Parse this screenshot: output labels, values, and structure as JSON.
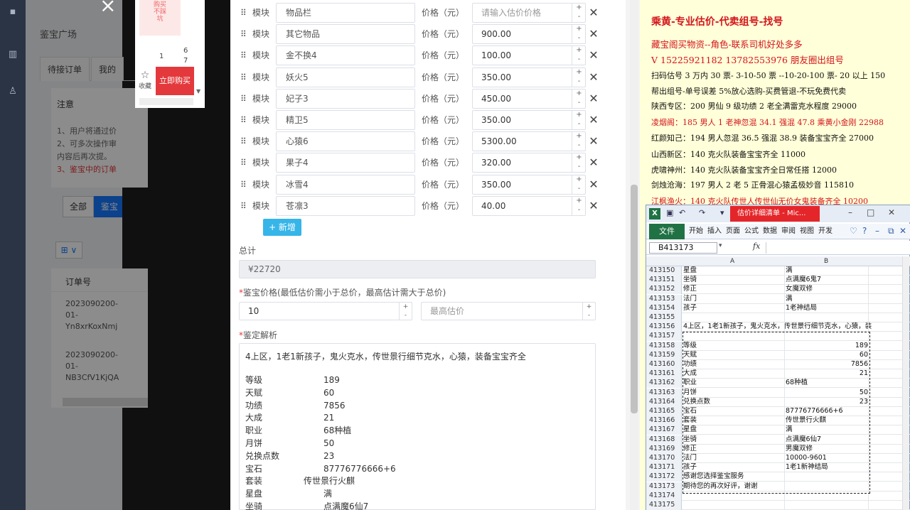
{
  "rail": {
    "icons": [
      "chart-icon",
      "user-icon"
    ]
  },
  "background_app": {
    "title": "鉴宝广场",
    "tabs": [
      "待接订单",
      "我的"
    ],
    "notice_title": "注意",
    "notice_lines": [
      "1、用户将通过价",
      "2、可多次操作审",
      "内容后再次提。",
      "3、鉴宝中的订单"
    ],
    "filter_all": "全部",
    "filter_active": "鉴宝",
    "grid_button": "⊞ ∨",
    "table_header": "订单号",
    "rows": [
      [
        "2023090200-",
        "01-",
        "Yn8xrKoxNmj"
      ],
      [
        "2023090200-",
        "01-",
        "NB3CfV1KjQA"
      ]
    ]
  },
  "ad_widget": {
    "image_text": "购买\n不踩\n坑",
    "nums": [
      "1",
      "6",
      "7"
    ],
    "fav_label": "收藏",
    "buy_label": "立即购买"
  },
  "form": {
    "module_label": "模块",
    "price_label": "价格（元）",
    "price_placeholder": "请输入估价价格",
    "modules": [
      {
        "name": "物品栏",
        "price": ""
      },
      {
        "name": "其它物品",
        "price": "900.00"
      },
      {
        "name": "金不换4",
        "price": "100.00"
      },
      {
        "name": "妖火5",
        "price": "350.00"
      },
      {
        "name": "妃子3",
        "price": "450.00"
      },
      {
        "name": "精卫5",
        "price": "350.00"
      },
      {
        "name": "心猿6",
        "price": "5300.00"
      },
      {
        "name": "果子4",
        "price": "320.00"
      },
      {
        "name": "冰雪4",
        "price": "350.00"
      },
      {
        "name": "苍凛3",
        "price": "40.00"
      }
    ],
    "add_button": "+ 新增",
    "total_label": "总计",
    "total_value": "¥22720",
    "appraise_label": "鉴宝价格(最低估价需小于总价，最高估计需大于总价)",
    "min_price": "10",
    "max_placeholder": "最高估价",
    "analysis_label": "鉴定解析",
    "analysis_summary": "4上区，1老1新孩子，鬼火克水，传世景行细节克水，心猿，装备宝宝齐全",
    "analysis_rows": [
      {
        "k": "等级",
        "v": "189"
      },
      {
        "k": "天赋",
        "v": "60"
      },
      {
        "k": "功绩",
        "v": "7856"
      },
      {
        "k": "大成",
        "v": "21"
      },
      {
        "k": "职业",
        "v": "68种植"
      },
      {
        "k": "月饼",
        "v": "50"
      },
      {
        "k": "兑换点数",
        "v": "23"
      },
      {
        "k": "宝石",
        "v": "87776776666+6"
      },
      {
        "k": "套装",
        "v": "传世景行火麒"
      },
      {
        "k": "星盘",
        "v": "满"
      },
      {
        "k": "坐骑",
        "v": "点满魔6仙7"
      }
    ]
  },
  "doc": {
    "heading": "乘黄-专业估价-代卖组号-找号",
    "line1": "藏宝阁买物资--角色-联系司机好处多多",
    "line2": "V 15225921182      13782553976 朋友圈出组号",
    "line3": "扫码估号 3 万内 30 票- 3-10-50 票  --10-20-100 票- 20 以上 150",
    "line4": "帮出组号-单号误差 5%放心选购-买费管退-不玩免费代卖",
    "line5": "陕西专区：200 男仙 9 级功绩 2 老全满雷克水程度 29000",
    "line6": "凌烟阁：185 男人 1 老神忽混 34.1 强混 47.8 乘黄小金刚 22988",
    "line7": "红颜知己：194 男人忽混 36.5 强混 38.9 装备宝宝齐全 27000",
    "line8": "山西新区：140 克火队装备宝宝齐全 11000",
    "line9": "虎啸神州：140 克火队装备宝宝齐全日常任搭 12000",
    "line10": "剑烛沧海：197 男人 2 老 5 正骨混心猿孟极妙音 115810",
    "line11": "江枫渔火：140 克火队传世人传世仙无价女鬼装备齐全 10200"
  },
  "excel": {
    "window_title": "估价详细清单 - Mic...",
    "file_tab": "文件",
    "ribbon_tabs": [
      "开始",
      "插入",
      "页面",
      "公式",
      "数据",
      "审阅",
      "视图",
      "开发"
    ],
    "name_box": "B413173",
    "fx": "fx",
    "col_a": "A",
    "col_b": "B",
    "rows": [
      {
        "n": "413150",
        "a": "星盘",
        "b": "满"
      },
      {
        "n": "413151",
        "a": "坐骑",
        "b": "点满魔6鬼7"
      },
      {
        "n": "413152",
        "a": "修正",
        "b": "女魔双修"
      },
      {
        "n": "413153",
        "a": "法门",
        "b": "满"
      },
      {
        "n": "413154",
        "a": "孩子",
        "b": "1老神结局"
      },
      {
        "n": "413155",
        "a": "",
        "b": ""
      },
      {
        "n": "413156",
        "a": "4上区，1老1新孩子，鬼火克水，传世景行细节克水，心猿，装",
        "b": ""
      },
      {
        "n": "413157",
        "a": "",
        "b": ""
      },
      {
        "n": "413158",
        "a": "等级",
        "b": "189",
        "num": true
      },
      {
        "n": "413159",
        "a": "天赋",
        "b": "60",
        "num": true
      },
      {
        "n": "413160",
        "a": "功绩",
        "b": "7856",
        "num": true
      },
      {
        "n": "413161",
        "a": "大成",
        "b": "21",
        "num": true
      },
      {
        "n": "413162",
        "a": "职业",
        "b": "68种植"
      },
      {
        "n": "413163",
        "a": "月饼",
        "b": "50",
        "num": true
      },
      {
        "n": "413164",
        "a": "兑换点数",
        "b": "23",
        "num": true
      },
      {
        "n": "413165",
        "a": "宝石",
        "b": "87776776666+6"
      },
      {
        "n": "413166",
        "a": "套装",
        "b": "传世景行火麒"
      },
      {
        "n": "413167",
        "a": "星盘",
        "b": "满"
      },
      {
        "n": "413168",
        "a": "坐骑",
        "b": "点满魔6仙7"
      },
      {
        "n": "413169",
        "a": "修正",
        "b": "男魔双修"
      },
      {
        "n": "413170",
        "a": "法门",
        "b": "10000-9601"
      },
      {
        "n": "413171",
        "a": "孩子",
        "b": "1老1新神结局"
      },
      {
        "n": "413172",
        "a": "感谢您选择鉴宝服务",
        "b": ""
      },
      {
        "n": "413173",
        "a": "期待您的再次好评，谢谢",
        "b": ""
      },
      {
        "n": "413174",
        "a": "",
        "b": ""
      },
      {
        "n": "413175",
        "a": "",
        "b": ""
      }
    ]
  }
}
